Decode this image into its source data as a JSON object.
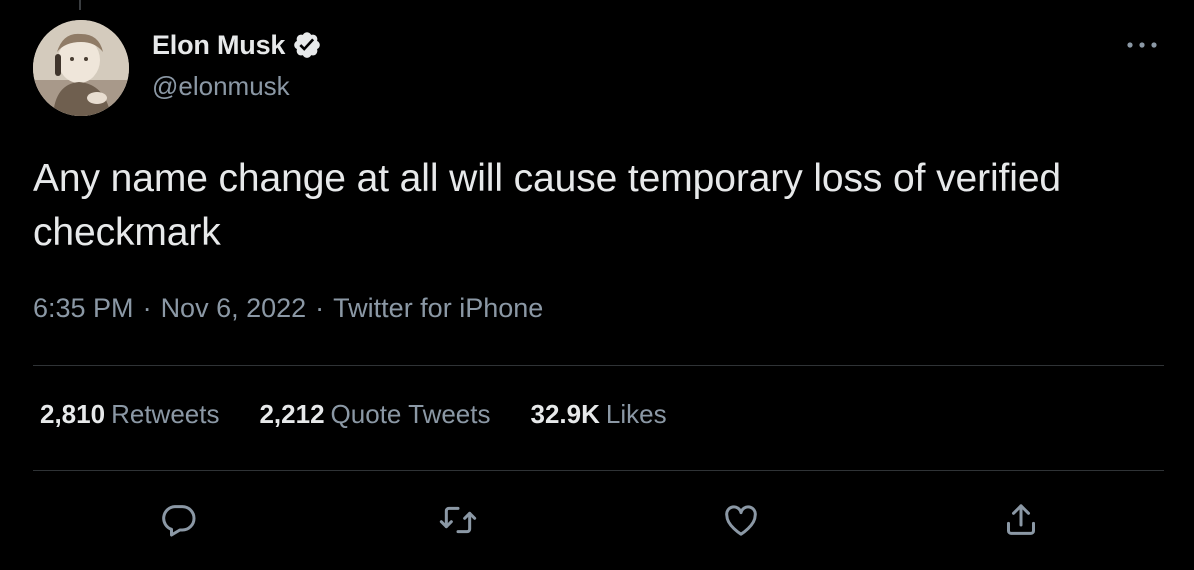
{
  "user": {
    "display_name": "Elon Musk",
    "handle": "@elonmusk",
    "verified": true,
    "avatar_icon": "avatar-photo"
  },
  "tweet": {
    "text": "Any name change at all will cause temporary loss of verified checkmark",
    "time": "6:35 PM",
    "date": "Nov 6, 2022",
    "source": "Twitter for iPhone",
    "separator": "·"
  },
  "stats": {
    "retweets": {
      "count": "2,810",
      "label": "Retweets"
    },
    "quote_tweets": {
      "count": "2,212",
      "label": "Quote Tweets"
    },
    "likes": {
      "count": "32.9K",
      "label": "Likes"
    }
  },
  "actions": [
    {
      "icon": "reply-icon"
    },
    {
      "icon": "retweet-icon"
    },
    {
      "icon": "like-icon"
    },
    {
      "icon": "share-icon"
    }
  ],
  "colors": {
    "background": "#000000",
    "primary_text": "#e7e9ea",
    "secondary_text": "#8b98a5",
    "divider": "#2f3336",
    "icon": "#8b98a5"
  }
}
